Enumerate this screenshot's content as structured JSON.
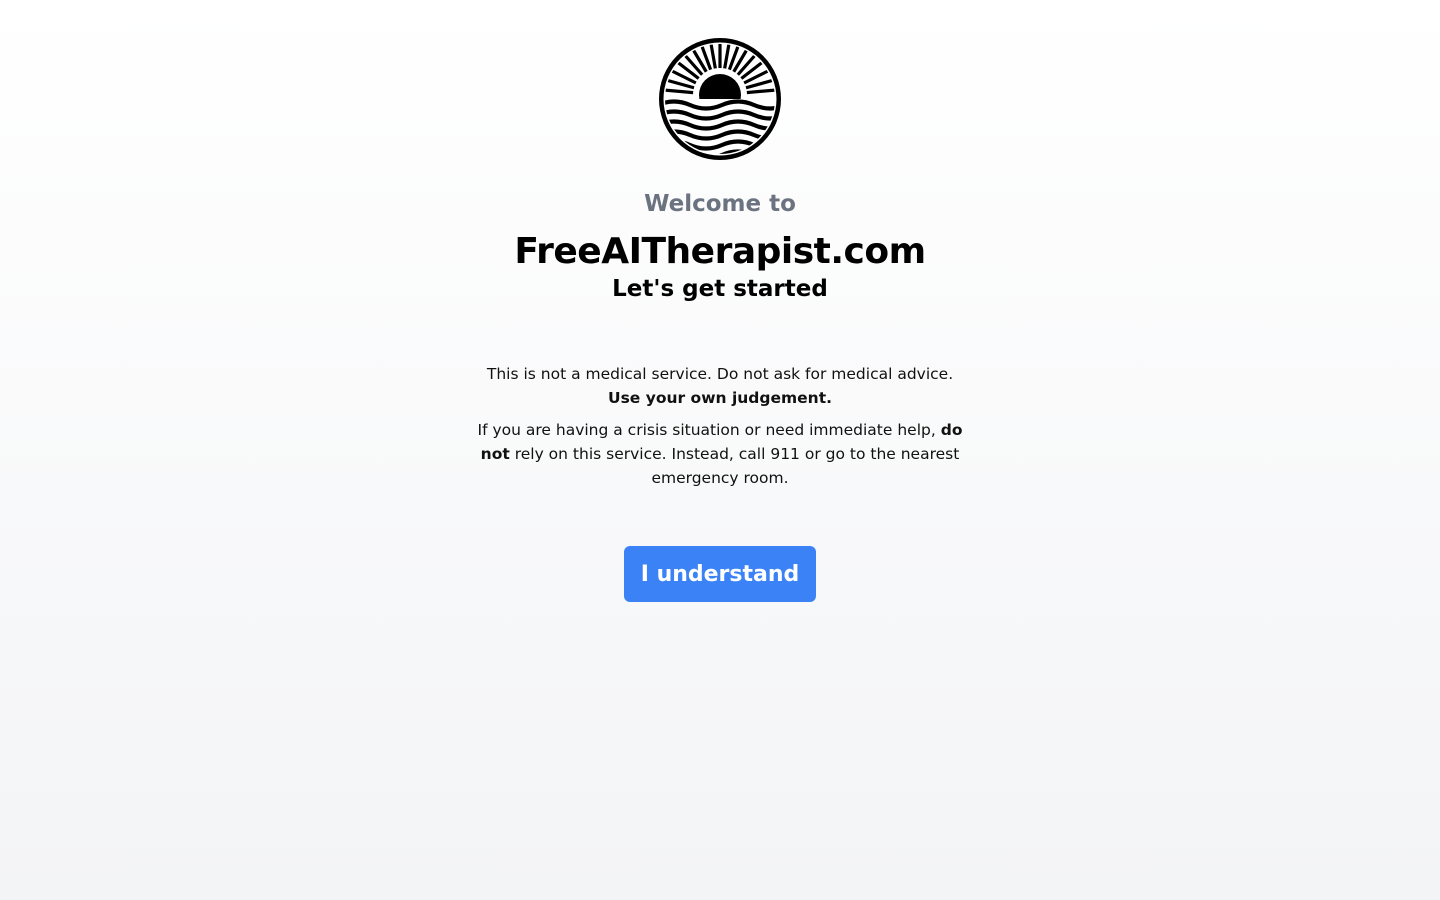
{
  "header": {
    "logo_icon": "sunset-over-waves-logo",
    "welcome_text": "Welcome to",
    "site_title": "FreeAITherapist.com",
    "subtitle": "Let's get started"
  },
  "disclaimer": {
    "paragraph1_text": "This is not a medical service. Do not ask for medical advice.",
    "paragraph1_bold": "Use your own judgement.",
    "paragraph2_text_before": "If you are having a crisis situation or need immediate help,",
    "paragraph2_bold": "do not",
    "paragraph2_text_after": "rely on this service. Instead, call 911 or go to the nearest emergency room."
  },
  "actions": {
    "confirm_label": "I understand"
  },
  "colors": {
    "accent": "#3b82f6",
    "muted_text": "#6b7280",
    "background_top": "#ffffff",
    "background_bottom": "#f3f4f6"
  }
}
